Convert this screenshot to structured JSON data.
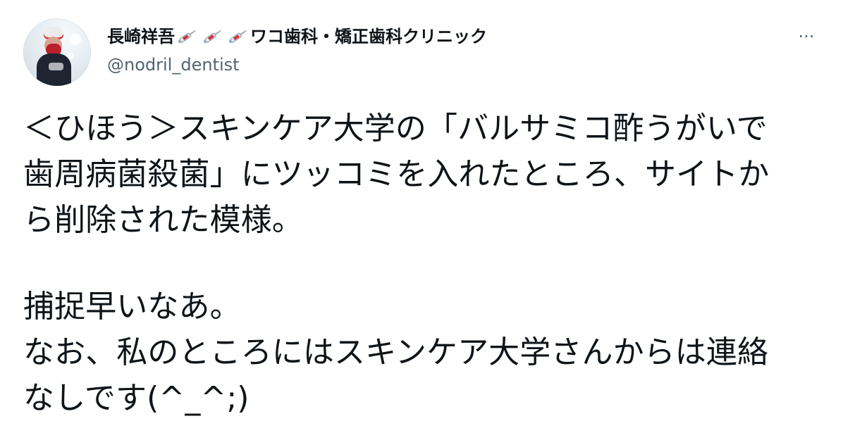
{
  "tweet": {
    "author": {
      "display_name": "長崎祥吾",
      "display_name_suffix": "ワコ歯科・矯正歯科クリニック",
      "emoji_icons": [
        "syringe-icon",
        "syringe-icon",
        "syringe-icon"
      ],
      "handle": "@nodril_dentist"
    },
    "more_label": "···",
    "lines": [
      "＜ひほう＞スキンケア大学の「バルサミコ酢うがいで",
      "歯周病菌殺菌」にツッコミを入れたところ、サイトか",
      "ら削除された模様。",
      "",
      "捕捉早いなあ。",
      "なお、私のところにはスキンケア大学さんからは連絡",
      "なしです(^_^;)"
    ],
    "colors": {
      "text": "#0f1419",
      "secondary": "#536471",
      "background": "#ffffff"
    }
  }
}
